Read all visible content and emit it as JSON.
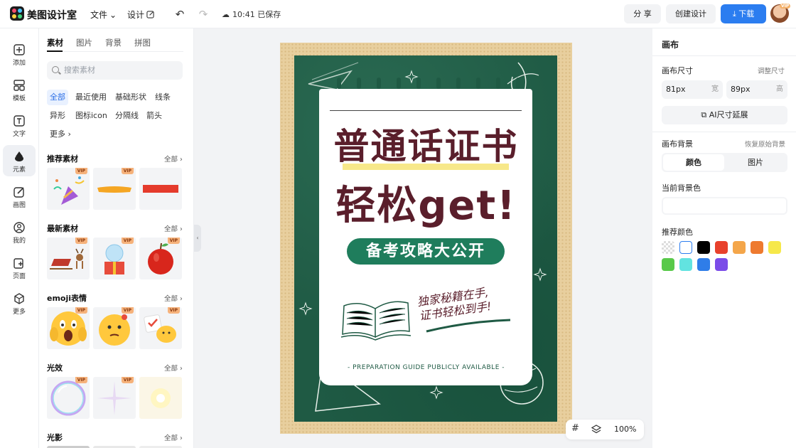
{
  "app": {
    "name": "美图设计室"
  },
  "topbar": {
    "file_label": "文件",
    "design_label": "设计",
    "save_status": "10:41 已保存",
    "share_label": "分 享",
    "create_label": "创建设计",
    "download_label": "下载",
    "vip_badge": "VIP"
  },
  "rail": {
    "items": [
      {
        "label": "添加",
        "icon": "plus-icon"
      },
      {
        "label": "模板",
        "icon": "template-icon"
      },
      {
        "label": "文字",
        "icon": "text-icon"
      },
      {
        "label": "元素",
        "icon": "shapes-icon"
      },
      {
        "label": "画图",
        "icon": "draw-icon"
      },
      {
        "label": "我的",
        "icon": "user-icon"
      },
      {
        "label": "页面",
        "icon": "page-icon"
      },
      {
        "label": "更多",
        "icon": "more-icon"
      }
    ]
  },
  "panel": {
    "tabs": [
      "素材",
      "图片",
      "背景",
      "拼图"
    ],
    "search_placeholder": "搜索素材",
    "chips": [
      "全部",
      "最近使用",
      "基础形状",
      "线条",
      "异形",
      "图标icon",
      "分隔线",
      "箭头",
      "更多"
    ],
    "sections": [
      {
        "title": "推荐素材",
        "all": "全部"
      },
      {
        "title": "最新素材",
        "all": "全部"
      },
      {
        "title": "emoji表情",
        "all": "全部"
      },
      {
        "title": "光效",
        "all": "全部"
      },
      {
        "title": "光影",
        "all": "全部"
      }
    ],
    "vip": "VIP"
  },
  "canvas": {
    "title_line1": "普通话证书",
    "title_line2": "轻松get!",
    "pill_text": "备考攻略大公开",
    "hand_line1": "独家秘籍在手,",
    "hand_line2": "证书轻松到手!",
    "footer": "- PREPARATION GUIDE PUBLICLY AVAILABLE -",
    "zoom": "100%"
  },
  "props": {
    "title": "画布",
    "size_label": "画布尺寸",
    "size_adjust": "调整尺寸",
    "width_value": "81px",
    "width_unit": "宽",
    "height_value": "89px",
    "height_unit": "高",
    "ai_extend": "AI尺寸延展",
    "bg_label": "画布背景",
    "bg_reset": "恢复原始背景",
    "seg_color": "颜色",
    "seg_image": "图片",
    "current_bg_label": "当前背景色",
    "recommend_label": "推荐颜色",
    "swatches": [
      "transparent",
      "#ffffff",
      "#000000",
      "#e8412c",
      "#f4a64a",
      "#ee7a2f",
      "#f6e84a",
      "#58c94a",
      "#62e3e0",
      "#2f7de8",
      "#7b4ce8"
    ]
  },
  "colors": {
    "accent": "#2b7df0",
    "chalkboard": "#1f5a44",
    "title": "#5a1e2b"
  }
}
